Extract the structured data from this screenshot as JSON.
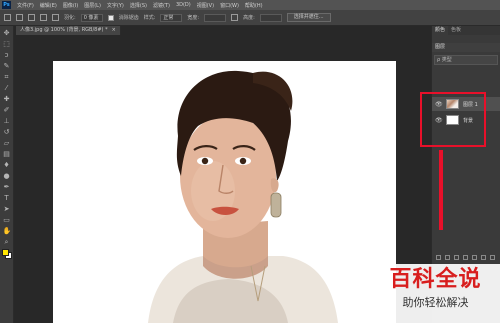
{
  "app": {
    "logo_text": "Ps"
  },
  "menu": [
    "文件(F)",
    "编辑(E)",
    "图像(I)",
    "图层(L)",
    "文字(Y)",
    "选择(S)",
    "滤镜(T)",
    "3D(D)",
    "视图(V)",
    "窗口(W)",
    "帮助(H)"
  ],
  "options": {
    "feather_label": "羽化:",
    "feather_value": "0 像素",
    "antialias_label": "消除锯齿",
    "style_label": "样式:",
    "style_value": "正常",
    "width_label": "宽度:",
    "height_label": "高度:",
    "select_mask_button": "选择并遮住..."
  },
  "document": {
    "tab_title": "人像3.jpg @ 100% (背景, RGB/8#) *",
    "close": "×"
  },
  "panels": {
    "tabs": [
      "颜色",
      "色板"
    ],
    "layers_title": "图层",
    "filter_kind": "ρ 类型",
    "layers": [
      {
        "name": "图层 1",
        "visible_icon": "👁",
        "thumb": "person"
      },
      {
        "name": "背景",
        "visible_icon": "👁",
        "thumb": "white"
      }
    ]
  },
  "watermark": {
    "main": "百科全说",
    "sub": "助你轻松解决"
  },
  "colors": {
    "foreground": "#ffe600",
    "background": "#ffffff",
    "highlight": "#e8102a"
  },
  "tools": [
    "move-icon",
    "marquee-icon",
    "lasso-icon",
    "quick-select-icon",
    "crop-icon",
    "eyedropper-icon",
    "healing-icon",
    "brush-icon",
    "stamp-icon",
    "history-brush-icon",
    "eraser-icon",
    "gradient-icon",
    "blur-icon",
    "dodge-icon",
    "pen-icon",
    "type-icon",
    "path-select-icon",
    "shape-icon",
    "hand-icon",
    "zoom-icon"
  ]
}
